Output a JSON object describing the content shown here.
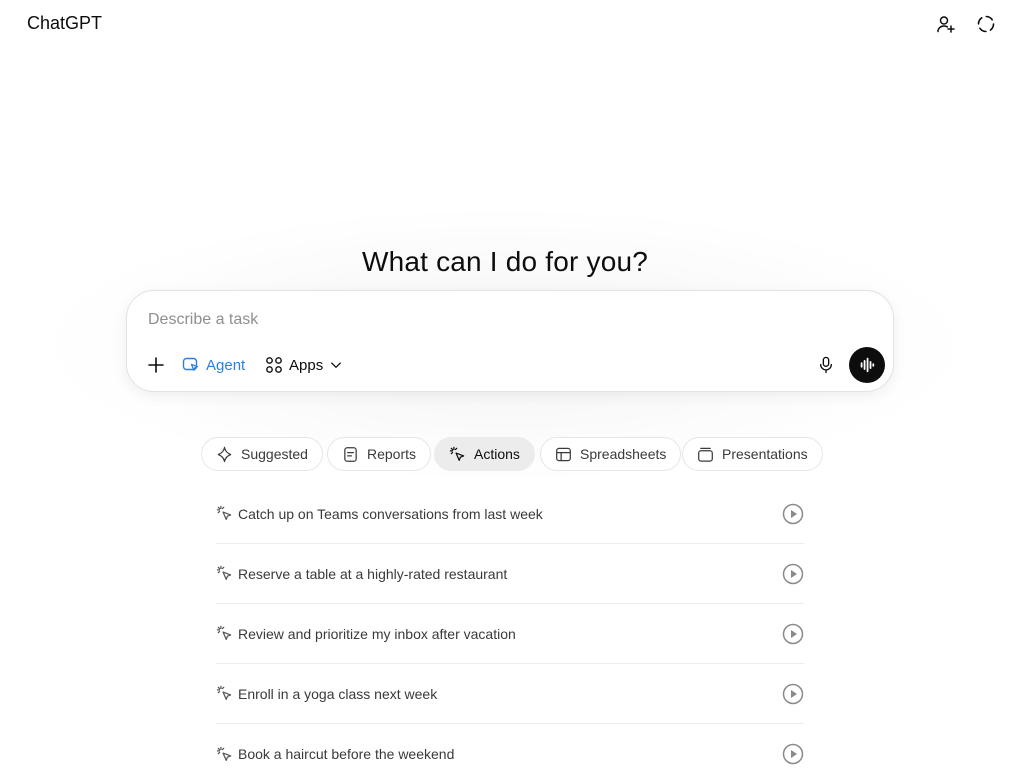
{
  "app": {
    "brand": "ChatGPT"
  },
  "header": {
    "add_person_icon": "add-person-icon",
    "temporary_chat_icon": "dashed-circle-icon"
  },
  "hero": {
    "headline": "What can I do for you?"
  },
  "composer": {
    "placeholder": "Describe a task",
    "agent_label": "Agent",
    "apps_label": "Apps",
    "accent": "#2b7fe0"
  },
  "tabs": [
    {
      "label": "Suggested",
      "icon": "sparkle-icon",
      "active": false
    },
    {
      "label": "Reports",
      "icon": "document-icon",
      "active": false
    },
    {
      "label": "Actions",
      "icon": "cursor-click-icon",
      "active": true
    },
    {
      "label": "Spreadsheets",
      "icon": "table-icon",
      "active": false
    },
    {
      "label": "Presentations",
      "icon": "slides-icon",
      "active": false
    }
  ],
  "actions": [
    {
      "label": "Catch up on Teams conversations from last week"
    },
    {
      "label": "Reserve a table at a highly-rated restaurant"
    },
    {
      "label": "Review and prioritize my inbox after vacation"
    },
    {
      "label": "Enroll in a yoga class next week"
    },
    {
      "label": "Book a haircut before the weekend"
    }
  ]
}
